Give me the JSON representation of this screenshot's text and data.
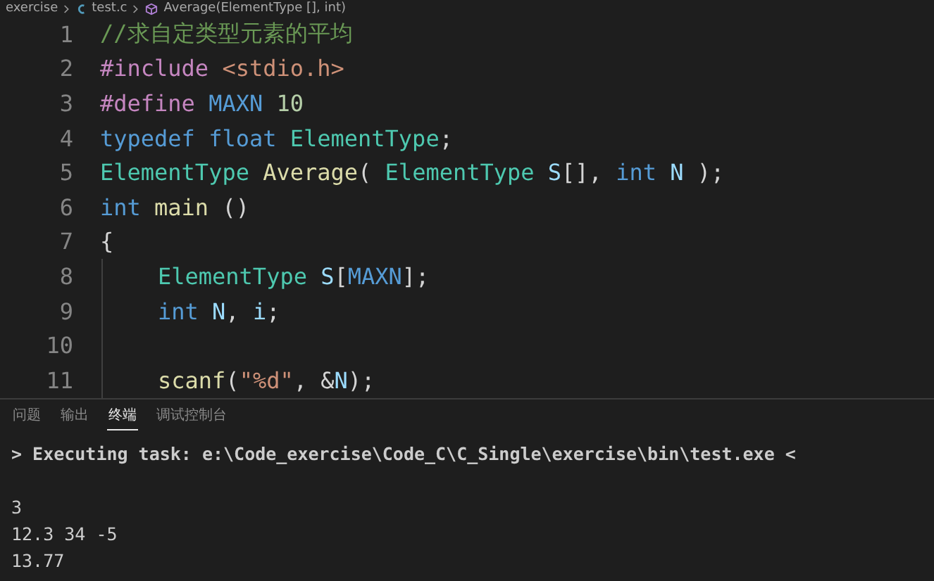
{
  "breadcrumb": [
    {
      "kind": "folder",
      "label": "exercise"
    },
    {
      "kind": "file",
      "label": "test.c"
    },
    {
      "kind": "symbol",
      "label": "Average(ElementType [], int)"
    }
  ],
  "code_lines": [
    {
      "number": "1",
      "tokens": [
        {
          "kind": "comment",
          "text": "//求自定类型元素的平均"
        }
      ]
    },
    {
      "number": "2",
      "tokens": [
        {
          "kind": "directive",
          "text": "#include "
        },
        {
          "kind": "string",
          "text": "<stdio.h>"
        }
      ]
    },
    {
      "number": "3",
      "tokens": [
        {
          "kind": "directive",
          "text": "#define "
        },
        {
          "kind": "keyword",
          "text": "MAXN "
        },
        {
          "kind": "number",
          "text": "10"
        }
      ]
    },
    {
      "number": "4",
      "tokens": [
        {
          "kind": "keyword",
          "text": "typedef float "
        },
        {
          "kind": "type",
          "text": "ElementType"
        },
        {
          "kind": "plain",
          "text": ";"
        }
      ]
    },
    {
      "number": "5",
      "tokens": [
        {
          "kind": "type",
          "text": "ElementType "
        },
        {
          "kind": "func",
          "text": "Average"
        },
        {
          "kind": "plain",
          "text": "( "
        },
        {
          "kind": "type",
          "text": "ElementType "
        },
        {
          "kind": "var",
          "text": "S"
        },
        {
          "kind": "plain",
          "text": "[], "
        },
        {
          "kind": "keyword",
          "text": "int "
        },
        {
          "kind": "var",
          "text": "N"
        },
        {
          "kind": "plain",
          "text": " );"
        }
      ]
    },
    {
      "number": "6",
      "tokens": [
        {
          "kind": "keyword",
          "text": "int "
        },
        {
          "kind": "func",
          "text": "main"
        },
        {
          "kind": "plain",
          "text": " ()"
        }
      ]
    },
    {
      "number": "7",
      "tokens": [
        {
          "kind": "plain",
          "text": "{"
        }
      ]
    },
    {
      "number": "8",
      "indented": true,
      "tokens": [
        {
          "kind": "type",
          "text": "ElementType "
        },
        {
          "kind": "var",
          "text": "S"
        },
        {
          "kind": "plain",
          "text": "["
        },
        {
          "kind": "keyword",
          "text": "MAXN"
        },
        {
          "kind": "plain",
          "text": "];"
        }
      ]
    },
    {
      "number": "9",
      "indented": true,
      "tokens": [
        {
          "kind": "keyword",
          "text": "int "
        },
        {
          "kind": "var",
          "text": "N"
        },
        {
          "kind": "plain",
          "text": ", "
        },
        {
          "kind": "var",
          "text": "i"
        },
        {
          "kind": "plain",
          "text": ";"
        }
      ]
    },
    {
      "number": "10",
      "indented": true
    },
    {
      "number": "11",
      "indented": true,
      "tokens": [
        {
          "kind": "func",
          "text": "scanf"
        },
        {
          "kind": "plain",
          "text": "("
        },
        {
          "kind": "string",
          "text": "\"%d\""
        },
        {
          "kind": "plain",
          "text": ", &"
        },
        {
          "kind": "var",
          "text": "N"
        },
        {
          "kind": "plain",
          "text": ");"
        }
      ]
    }
  ],
  "panel_tabs": [
    {
      "label": "问题",
      "selected": false
    },
    {
      "label": "输出",
      "selected": false
    },
    {
      "label": "终端",
      "selected": true
    },
    {
      "label": "调试控制台",
      "selected": false
    }
  ],
  "terminal": {
    "task_line": "> Executing task: e:\\Code_exercise\\Code_C\\C_Single\\exercise\\bin\\test.exe <",
    "output": [
      "3",
      "12.3 34 -5",
      "13.77"
    ]
  }
}
